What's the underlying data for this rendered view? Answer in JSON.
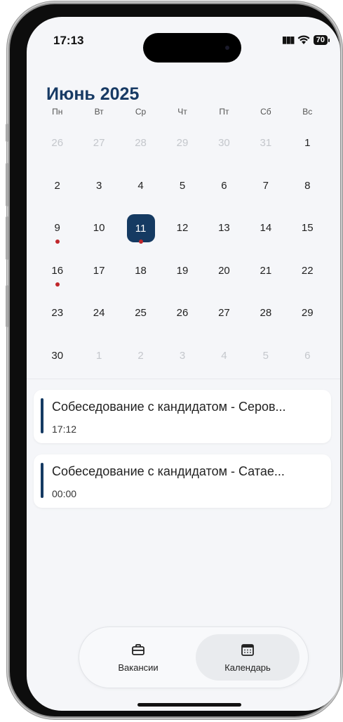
{
  "status_bar": {
    "time": "17:13",
    "battery": "70"
  },
  "calendar": {
    "month_title": "Июнь 2025",
    "weekdays": [
      "Пн",
      "Вт",
      "Ср",
      "Чт",
      "Пт",
      "Сб",
      "Вс"
    ],
    "days": [
      {
        "num": "26",
        "muted": true
      },
      {
        "num": "27",
        "muted": true
      },
      {
        "num": "28",
        "muted": true
      },
      {
        "num": "29",
        "muted": true
      },
      {
        "num": "30",
        "muted": true
      },
      {
        "num": "31",
        "muted": true
      },
      {
        "num": "1"
      },
      {
        "num": "2"
      },
      {
        "num": "3"
      },
      {
        "num": "4"
      },
      {
        "num": "5"
      },
      {
        "num": "6"
      },
      {
        "num": "7"
      },
      {
        "num": "8"
      },
      {
        "num": "9",
        "dot": true
      },
      {
        "num": "10"
      },
      {
        "num": "11",
        "selected": true,
        "dot": true
      },
      {
        "num": "12"
      },
      {
        "num": "13"
      },
      {
        "num": "14"
      },
      {
        "num": "15"
      },
      {
        "num": "16",
        "dot": true
      },
      {
        "num": "17"
      },
      {
        "num": "18"
      },
      {
        "num": "19"
      },
      {
        "num": "20"
      },
      {
        "num": "21"
      },
      {
        "num": "22"
      },
      {
        "num": "23"
      },
      {
        "num": "24"
      },
      {
        "num": "25"
      },
      {
        "num": "26"
      },
      {
        "num": "27"
      },
      {
        "num": "28"
      },
      {
        "num": "29"
      },
      {
        "num": "30"
      },
      {
        "num": "1",
        "muted": true
      },
      {
        "num": "2",
        "muted": true
      },
      {
        "num": "3",
        "muted": true
      },
      {
        "num": "4",
        "muted": true
      },
      {
        "num": "5",
        "muted": true
      },
      {
        "num": "6",
        "muted": true
      }
    ],
    "selected_color": "#153a62",
    "event_dot_color": "#c0262b"
  },
  "events": [
    {
      "title": "Собеседование с кандидатом - Серов...",
      "time": "17:12"
    },
    {
      "title": "Собеседование с кандидатом - Сатае...",
      "time": "00:00"
    }
  ],
  "tabbar": {
    "vacancies_label": "Вакансии",
    "vacancies_icon": "briefcase-icon",
    "calendar_label": "Календарь",
    "calendar_icon": "calendar-icon",
    "active_tab": "calendar"
  }
}
